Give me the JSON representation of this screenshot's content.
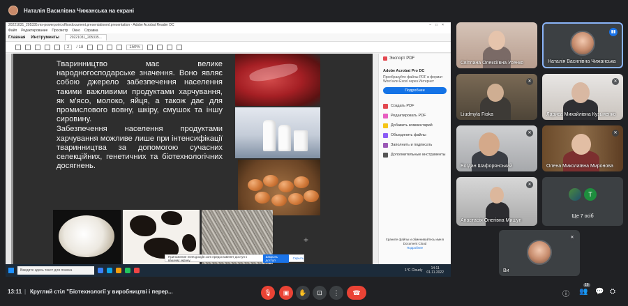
{
  "presenter": {
    "label": "Наталія Василівна Чижанська на екрані"
  },
  "acrobat": {
    "window_title": "20221031_205335.ms-powerpoint.officedocument.presentationml.presentation - Adobe Acrobat Reader DC",
    "menu": [
      "Файл",
      "Редактирование",
      "Просмотр",
      "Окно",
      "Справка"
    ],
    "tabs": [
      "Главная",
      "Инструменты"
    ],
    "doc_tab": "20221031_205335...",
    "page_current": "2",
    "page_total": "/ 18",
    "zoom": "150%",
    "side_panel": {
      "export_label": "Экспорт PDF",
      "promo_title": "Adobe Acrobat Pro DC",
      "promo_text": "Преобразуйте файлы PDF в формат Word или Excel через Интернет",
      "promo_button": "Подробнее",
      "items": [
        {
          "label": "Создать PDF",
          "color": "#e34850"
        },
        {
          "label": "Редактировать PDF",
          "color": "#e85dc0"
        },
        {
          "label": "Добавить комментарий",
          "color": "#f5c518"
        },
        {
          "label": "Объединить файлы",
          "color": "#8b5cf6"
        },
        {
          "label": "Заполнить и подписать",
          "color": "#9b59b6"
        },
        {
          "label": "Дополнительные инструменты",
          "color": "#555555"
        }
      ],
      "footer_text": "Храните файлы и обменивайтесь ими в Document Cloud",
      "footer_link": "Подробнее"
    }
  },
  "slide": {
    "paragraph1": "Тваринництво має велике народногосподарське значення. Воно являє собою джерело забезпечення населення такими важливими продуктами харчування, як м'ясо, молоко, яйця, а також дає для промислового вовну, шкіру, смушок та іншу сировину.",
    "paragraph2": "Забезпечення населення продуктами харчування можливе лише при інтенсифікації тваринництва за допомогою сучасних селекційних, генетичних та біотехнологічних досягнень."
  },
  "share_notice": {
    "text": "Приложение meet.google.com предоставляет доступ к вашему экрану.",
    "stop_label": "Закрыть доступ",
    "hide_label": "Скрыть"
  },
  "taskbar": {
    "search_placeholder": "Введите здесь текст для поиска",
    "weather": "1°C Cloudy",
    "time": "14:11",
    "date": "01.11.2022"
  },
  "participants": [
    {
      "id": "svitlana",
      "name": "Світлана Олексіївна Усенко"
    },
    {
      "id": "natalia",
      "name": "Наталія Василівна Чижанська"
    },
    {
      "id": "ludmyla",
      "name": "Liudmyla Fiokа"
    },
    {
      "id": "larysa",
      "name": "Лариса Михайлівна Кузьменко"
    },
    {
      "id": "bohdan",
      "name": "Богдан Шафорянський"
    },
    {
      "id": "olena",
      "name": "Олена Миколаївна Миронова"
    },
    {
      "id": "anastasia",
      "name": "Анастасія Олегівна Мишун"
    }
  ],
  "more_tile": {
    "label": "Ще 7 осіб",
    "avatar_letter": "T"
  },
  "self_tile": {
    "label": "Ви"
  },
  "meeting": {
    "time": "13:11",
    "divider": "|",
    "title": "Круглий стіл \"Біотехнології у виробництві і перер...",
    "participant_count": "16"
  }
}
